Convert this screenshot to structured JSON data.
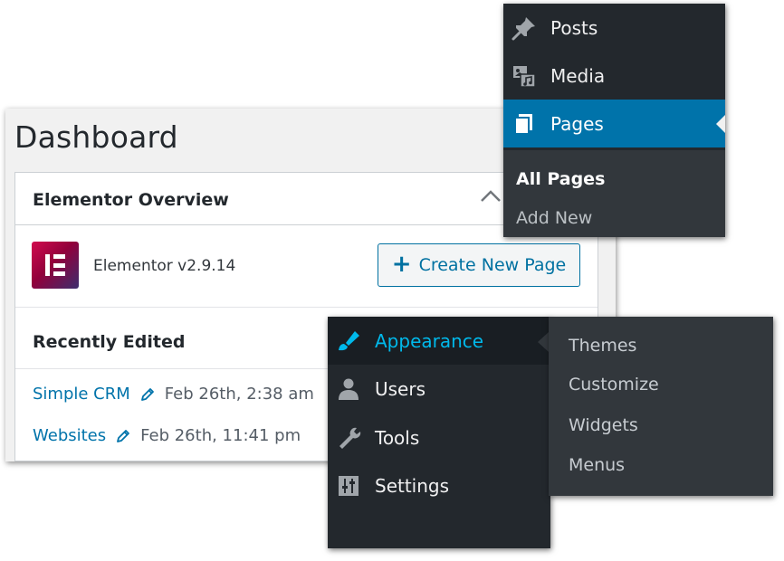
{
  "dashboard": {
    "title": "Dashboard",
    "widget": {
      "title": "Elementor Overview",
      "version": "Elementor v2.9.14",
      "create_button": "Create New Page",
      "recently_edited_title": "Recently Edited",
      "recent_items": [
        {
          "title": "Simple CRM",
          "date": "Feb 26th, 2:38 am"
        },
        {
          "title": "Websites",
          "date": "Feb 26th, 11:41 pm"
        }
      ]
    }
  },
  "admin_menu_top": {
    "items": [
      {
        "label": "Posts",
        "icon": "pushpin-icon"
      },
      {
        "label": "Media",
        "icon": "media-icon"
      },
      {
        "label": "Pages",
        "icon": "pages-icon",
        "active": true
      }
    ],
    "submenu": [
      {
        "label": "All Pages",
        "current": true
      },
      {
        "label": "Add New",
        "current": false
      }
    ]
  },
  "admin_menu_bottom": {
    "items": [
      {
        "label": "Appearance",
        "icon": "paintbrush-icon",
        "hover": true
      },
      {
        "label": "Users",
        "icon": "user-icon"
      },
      {
        "label": "Tools",
        "icon": "wrench-icon"
      },
      {
        "label": "Settings",
        "icon": "settings-sliders-icon"
      }
    ],
    "flyout": [
      "Themes",
      "Customize",
      "Widgets",
      "Menus"
    ]
  },
  "colors": {
    "menu_bg": "#23282d",
    "submenu_bg": "#32373c",
    "active_blue": "#0073aa",
    "hover_text": "#00b9eb",
    "link": "#0073aa",
    "button_border": "#0071a1"
  }
}
